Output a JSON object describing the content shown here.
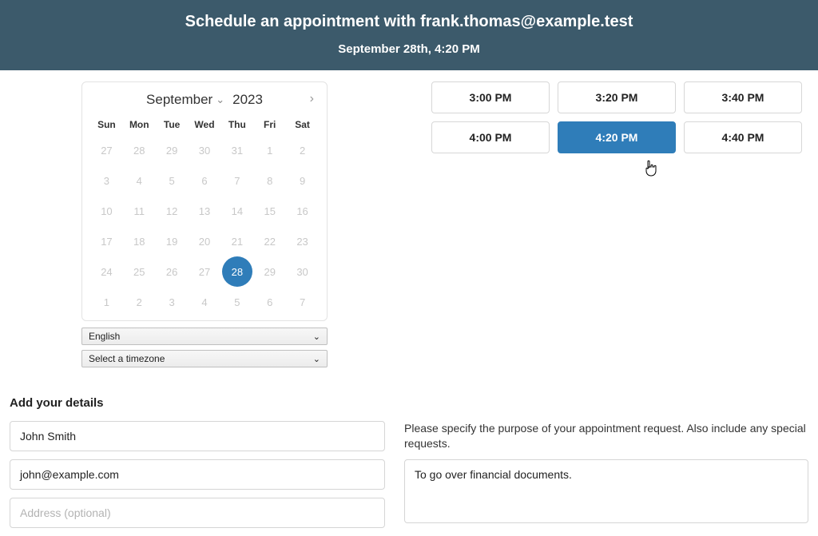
{
  "header": {
    "title": "Schedule an appointment with frank.thomas@example.test",
    "subtitle": "September 28th, 4:20 PM"
  },
  "calendar": {
    "month_label": "September",
    "year_label": "2023",
    "weekdays": [
      "Sun",
      "Mon",
      "Tue",
      "Wed",
      "Thu",
      "Fri",
      "Sat"
    ],
    "weeks": [
      [
        "27",
        "28",
        "29",
        "30",
        "31",
        "1",
        "2"
      ],
      [
        "3",
        "4",
        "5",
        "6",
        "7",
        "8",
        "9"
      ],
      [
        "10",
        "11",
        "12",
        "13",
        "14",
        "15",
        "16"
      ],
      [
        "17",
        "18",
        "19",
        "20",
        "21",
        "22",
        "23"
      ],
      [
        "24",
        "25",
        "26",
        "27",
        "28",
        "29",
        "30"
      ],
      [
        "1",
        "2",
        "3",
        "4",
        "5",
        "6",
        "7"
      ]
    ],
    "selected_day": "28",
    "selected_week_index": 4
  },
  "language_select": {
    "value": "English"
  },
  "timezone_select": {
    "value": "Select a timezone"
  },
  "time_slots": {
    "items": [
      "3:00 PM",
      "3:20 PM",
      "3:40 PM",
      "4:00 PM",
      "4:20 PM",
      "4:40 PM"
    ],
    "selected": "4:20 PM"
  },
  "details": {
    "heading": "Add your details",
    "name_value": "John Smith",
    "email_value": "john@example.com",
    "address_placeholder": "Address (optional)",
    "purpose_label": "Please specify the purpose of your appointment request. Also include any special requests.",
    "purpose_value": "To go over financial documents."
  }
}
